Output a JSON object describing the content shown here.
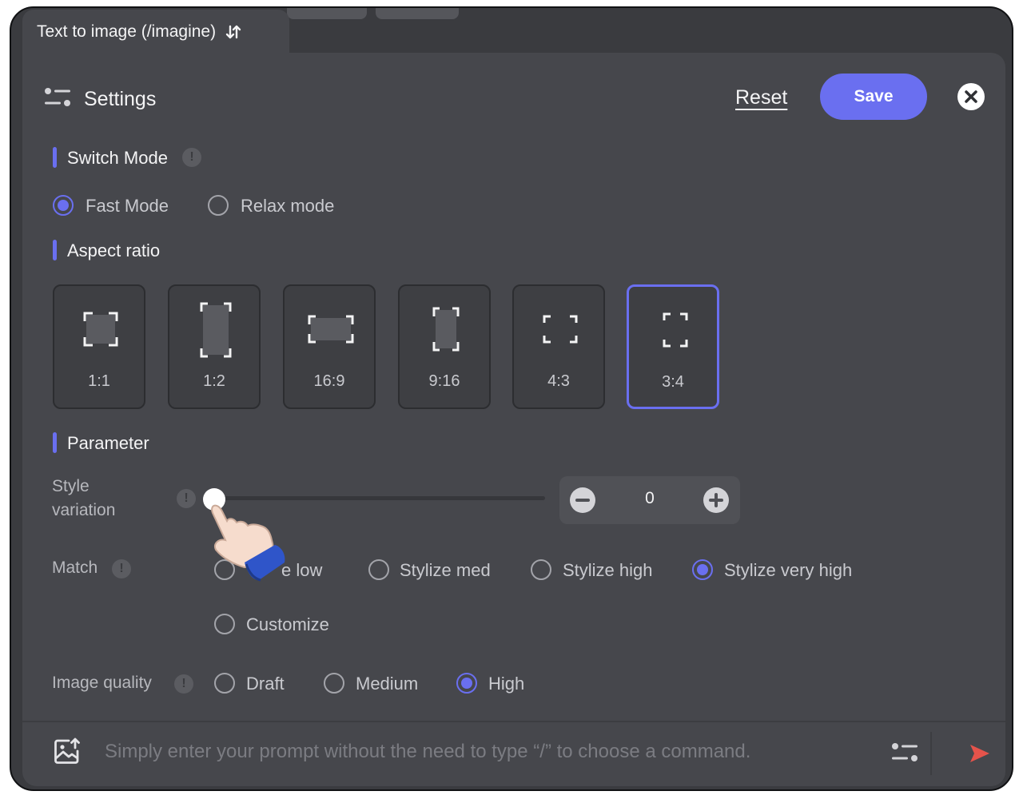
{
  "top_tab": {
    "label": "Text to image (/imagine)",
    "icon": "sort-arrows-icon"
  },
  "header": {
    "title": "Settings",
    "icon": "settings-sliders-icon",
    "reset_label": "Reset",
    "save_label": "Save",
    "close_icon": "close-circle-icon"
  },
  "switch_mode": {
    "title": "Switch Mode",
    "options": [
      {
        "label": "Fast Mode",
        "selected": true
      },
      {
        "label": "Relax mode",
        "selected": false
      }
    ]
  },
  "aspect_ratio": {
    "title": "Aspect ratio",
    "options": [
      {
        "label": "1:1",
        "selected": false
      },
      {
        "label": "1:2",
        "selected": false
      },
      {
        "label": "16:9",
        "selected": false
      },
      {
        "label": "9:16",
        "selected": false
      },
      {
        "label": "4:3",
        "selected": false
      },
      {
        "label": "3:4",
        "selected": true
      }
    ]
  },
  "parameter": {
    "title": "Parameter",
    "style_variation": {
      "label_line1": "Style",
      "label_line2": "variation",
      "value": "0",
      "slider_value": 0
    },
    "match": {
      "label": "Match",
      "options": [
        {
          "label": "e low",
          "selected": false
        },
        {
          "label": "Stylize med",
          "selected": false
        },
        {
          "label": "Stylize high",
          "selected": false
        },
        {
          "label": "Stylize very high",
          "selected": true
        },
        {
          "label": "Customize",
          "selected": false
        }
      ]
    },
    "image_quality": {
      "label": "Image quality",
      "options": [
        {
          "label": "Draft",
          "selected": false
        },
        {
          "label": "Medium",
          "selected": false
        },
        {
          "label": "High",
          "selected": true
        }
      ]
    }
  },
  "prompt_bar": {
    "placeholder": "Simply enter your prompt without the need to type “/” to choose a command.",
    "upload_icon": "image-upload-icon",
    "settings_icon": "settings-sliders-icon",
    "send_icon": "send-arrow-icon"
  },
  "colors": {
    "accent": "#6a6ff0",
    "send": "#e5534b",
    "panel": "#46474c"
  }
}
